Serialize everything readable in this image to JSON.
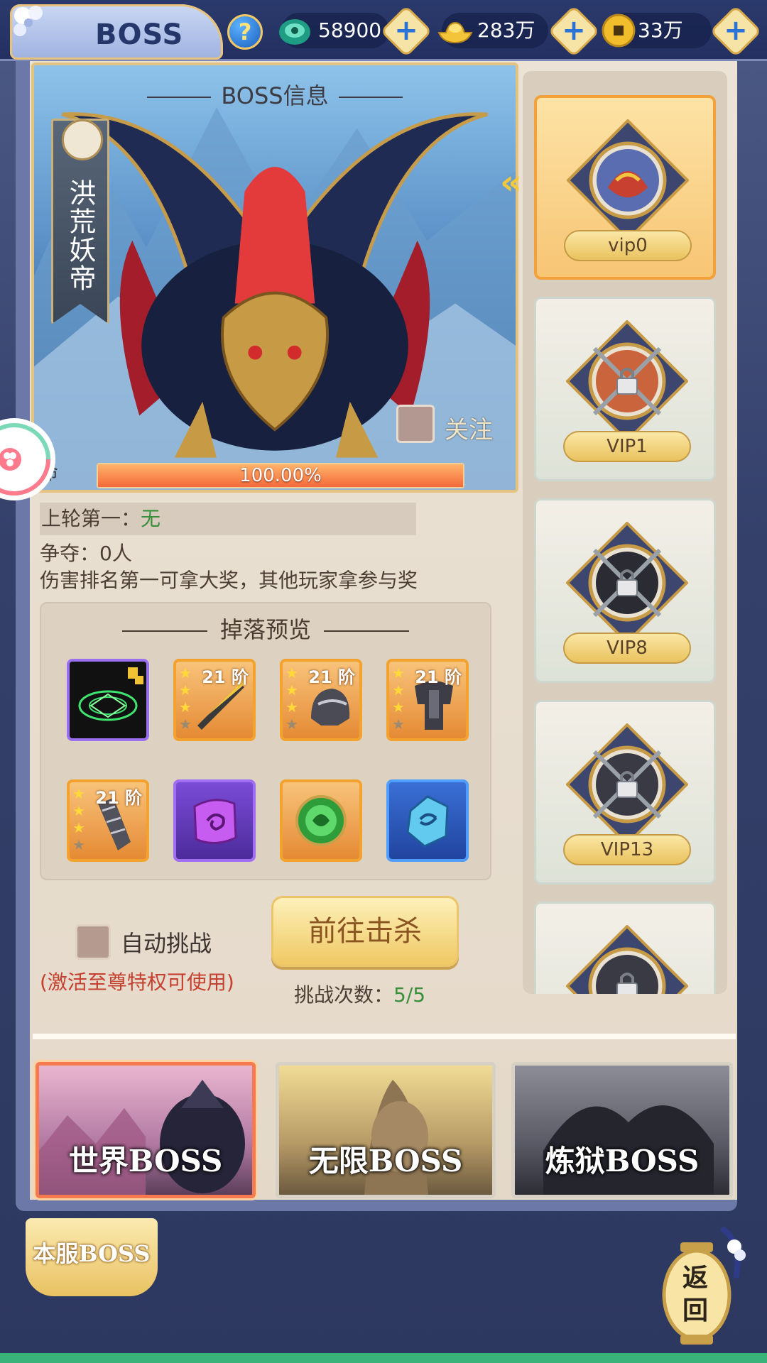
{
  "header": {
    "title": "BOSS",
    "help_icon": "question-icon",
    "currencies": [
      {
        "icon": "jade-icon",
        "value": "58900"
      },
      {
        "icon": "gold-ingot-icon",
        "value": "283万"
      },
      {
        "icon": "coin-icon",
        "value": "33万"
      }
    ]
  },
  "boss_info": {
    "header": "BOSS信息",
    "name": "洪荒妖帝",
    "follow_label": "关注",
    "hp_label": "命",
    "hp_percent_text": "100.00%",
    "hp_fraction": 1.0,
    "last_first_label": "上轮第一：",
    "last_first_value": "无",
    "contest_text": "争夺：0人",
    "rule_text": "伤害排名第一可拿大奖，其他玩家拿参与奖"
  },
  "drops": {
    "title": "掉落预览",
    "items": [
      {
        "name": "formation-fragment",
        "style": "dark",
        "stars": 0,
        "grade": ""
      },
      {
        "name": "sword-equipment",
        "style": "orange",
        "stars": 3,
        "grade": "21 阶"
      },
      {
        "name": "helmet-equipment",
        "style": "orange",
        "stars": 3,
        "grade": "21 阶"
      },
      {
        "name": "armor-equipment",
        "style": "orange",
        "stars": 3,
        "grade": "21 阶"
      },
      {
        "name": "gauntlet-equipment",
        "style": "orange",
        "stars": 3,
        "grade": "21 阶"
      },
      {
        "name": "purple-rune-stone",
        "style": "purple",
        "stars": 0,
        "grade": ""
      },
      {
        "name": "dragon-orb",
        "style": "orange",
        "stars": 0,
        "grade": ""
      },
      {
        "name": "blue-crystal",
        "style": "blue",
        "stars": 0,
        "grade": ""
      }
    ]
  },
  "auto_challenge": {
    "label": "自动挑战",
    "note": "(激活至尊特权可使用)"
  },
  "go_button": "前往击杀",
  "challenge": {
    "label": "挑战次数：",
    "value": "5/5"
  },
  "vip_list": [
    {
      "label": "vip0",
      "locked": false,
      "selected": true
    },
    {
      "label": "VIP1",
      "locked": true,
      "selected": false
    },
    {
      "label": "VIP8",
      "locked": true,
      "selected": false
    },
    {
      "label": "VIP13",
      "locked": true,
      "selected": false
    },
    {
      "label": "",
      "locked": true,
      "selected": false
    }
  ],
  "categories": [
    {
      "label": "世界BOSS",
      "active": true
    },
    {
      "label": "无限BOSS",
      "active": false
    },
    {
      "label": "炼狱BOSS",
      "active": false
    }
  ],
  "bottom": {
    "server_tag": "本服BOSS",
    "back_line1": "返",
    "back_line2": "回"
  },
  "colors": {
    "accent_orange": "#f3a22d",
    "green_text": "#3a8f3b",
    "red_note": "#c5402f"
  }
}
